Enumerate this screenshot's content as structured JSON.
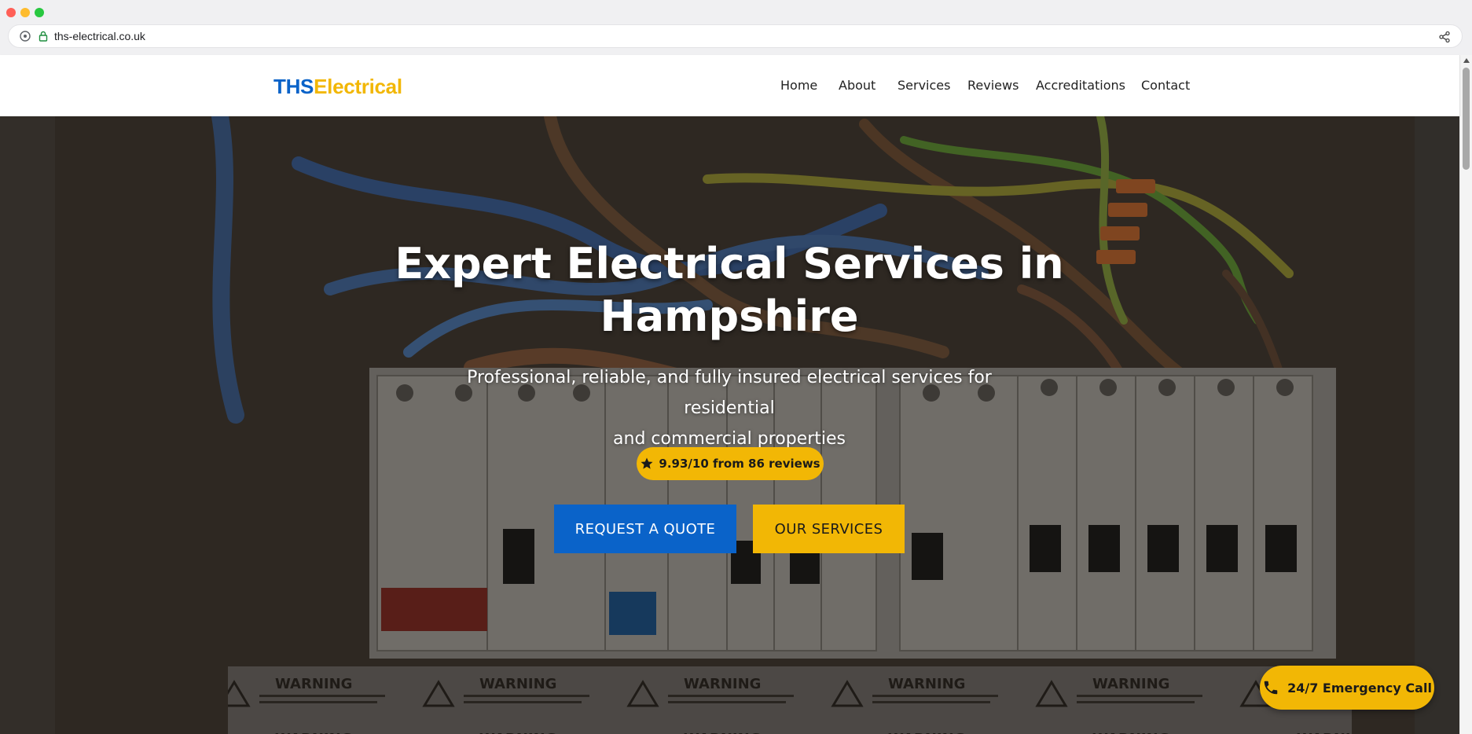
{
  "browser": {
    "url": "ths-electrical.co.uk"
  },
  "site": {
    "logo_part1": "THS",
    "logo_part2": "Electrical",
    "nav": [
      "Home",
      "About",
      "Services",
      "Reviews",
      "Accreditations",
      "Contact"
    ]
  },
  "hero": {
    "title_line1": "Expert Electrical Services in",
    "title_line2": "Hampshire",
    "subtitle_line1": "Professional, reliable, and fully insured electrical services for residential",
    "subtitle_line2": "and commercial properties",
    "rating": "9.93/10 from 86 reviews",
    "cta_primary": "REQUEST A QUOTE",
    "cta_secondary": "OUR SERVICES"
  },
  "emergency_button": "24/7 Emergency Call",
  "colors": {
    "brand_blue": "#0a63c9",
    "brand_yellow": "#f2b705"
  },
  "icons": [
    "tune-icon",
    "lock-icon",
    "share-icon",
    "star-icon",
    "phone-icon"
  ]
}
